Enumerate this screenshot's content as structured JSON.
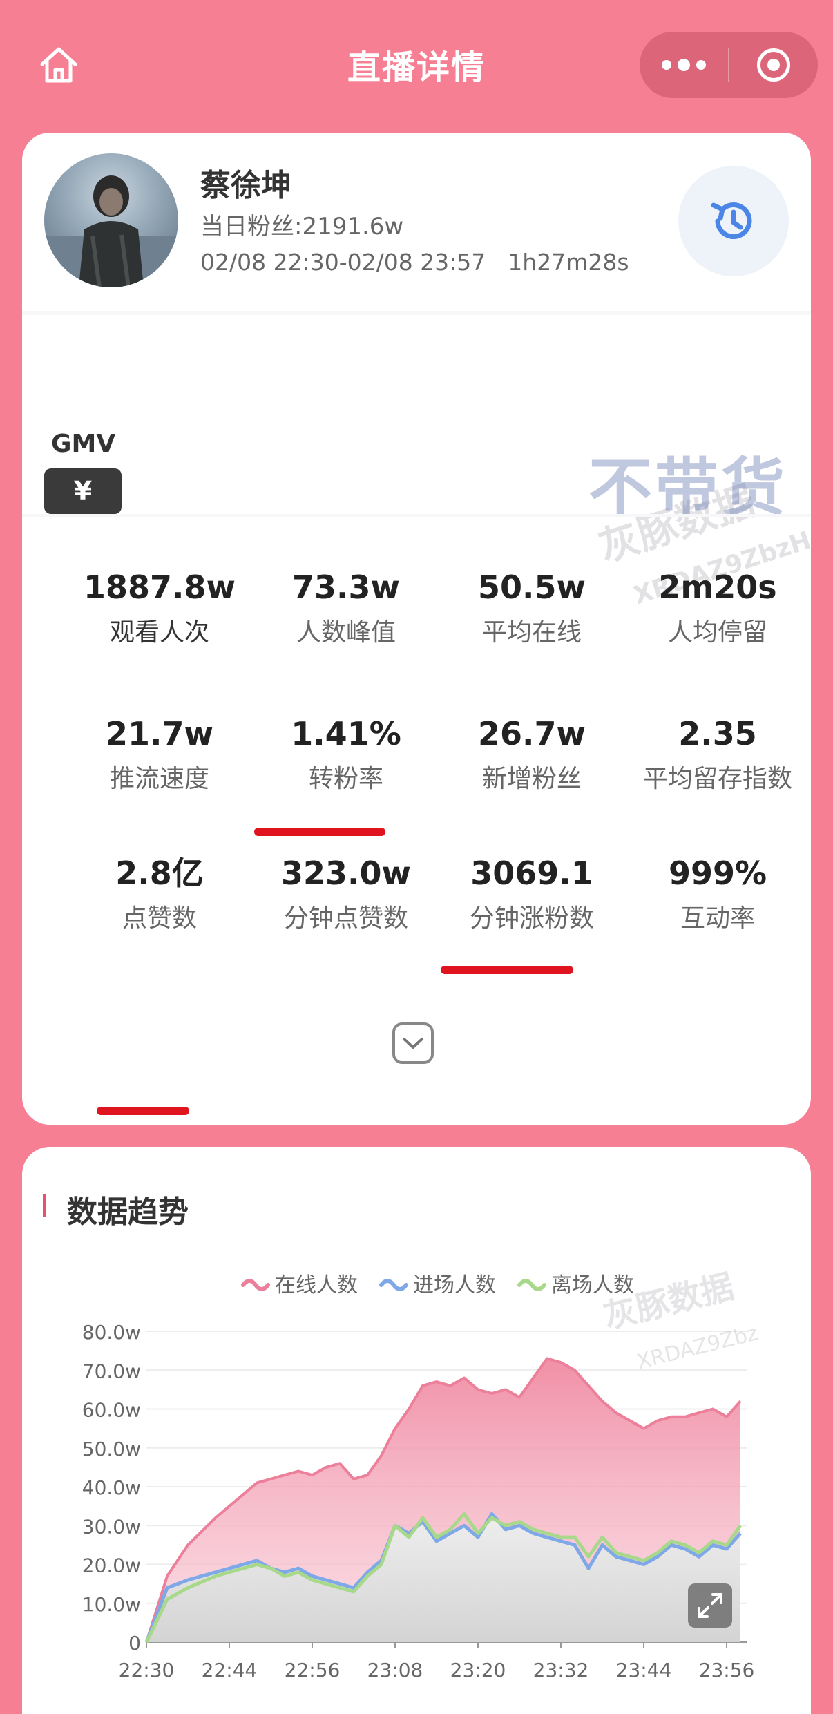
{
  "header": {
    "title": "直播详情",
    "home_icon": "home-icon",
    "more_icon": "more-dots-icon",
    "close_icon": "target-close-icon"
  },
  "profile": {
    "name": "蔡徐坤",
    "fans": "当日粉丝:2191.6w",
    "time_range": "02/08 22:30-02/08 23:57",
    "duration": "1h27m28s",
    "history_icon": "history-icon"
  },
  "gmv": {
    "label": "GMV",
    "badge": "¥",
    "status": "不带货"
  },
  "watermark": {
    "brand": "灰豚数据",
    "code": "XRDAZ9ZbzH",
    "code2": "XRDAZ9Zbz"
  },
  "stats": [
    {
      "value": "1887.8w",
      "label": "观看人次",
      "underlined": false
    },
    {
      "value": "73.3w",
      "label": "人数峰值",
      "underlined": true
    },
    {
      "value": "50.5w",
      "label": "平均在线",
      "underlined": false
    },
    {
      "value": "2m20s",
      "label": "人均停留",
      "underlined": false
    },
    {
      "value": "21.7w",
      "label": "推流速度",
      "underlined": false
    },
    {
      "value": "1.41%",
      "label": "转粉率",
      "underlined": false
    },
    {
      "value": "26.7w",
      "label": "新增粉丝",
      "underlined": true
    },
    {
      "value": "2.35",
      "label": "平均留存指数",
      "underlined": false
    },
    {
      "value": "2.8亿",
      "label": "点赞数",
      "underlined": true
    },
    {
      "value": "323.0w",
      "label": "分钟点赞数",
      "underlined": false
    },
    {
      "value": "3069.1",
      "label": "分钟涨粉数",
      "underlined": false
    },
    {
      "value": "999%",
      "label": "互动率",
      "underlined": false
    }
  ],
  "colors": {
    "background": "#f67f93",
    "online": "#ec7f9a",
    "enter": "#7fa8e8",
    "leave": "#a8d98a",
    "underline": "#e0141e"
  },
  "trend": {
    "title": "数据趋势",
    "fullscreen_icon": "fullscreen-icon"
  },
  "chart_data": {
    "type": "area",
    "title": "",
    "xlabel": "",
    "ylabel": "",
    "legend_position": "top-center",
    "grid": true,
    "ylim": [
      0,
      80
    ],
    "y_unit": "w",
    "y_ticks": [
      "0",
      "10.0w",
      "20.0w",
      "30.0w",
      "40.0w",
      "50.0w",
      "60.0w",
      "70.0w",
      "80.0w"
    ],
    "x_ticks": [
      "22:30",
      "22:44",
      "22:56",
      "23:08",
      "23:20",
      "23:32",
      "23:44",
      "23:56"
    ],
    "x_minutes": [
      0,
      3,
      6,
      10,
      14,
      16,
      18,
      20,
      22,
      24,
      26,
      28,
      30,
      32,
      34,
      36,
      38,
      40,
      42,
      44,
      46,
      48,
      50,
      52,
      54,
      56,
      58,
      60,
      62,
      64,
      66,
      68,
      70,
      72,
      74,
      76,
      78,
      80,
      82,
      84,
      86
    ],
    "series": [
      {
        "name": "在线人数",
        "values": [
          0,
          17,
          25,
          32,
          38,
          41,
          42,
          43,
          44,
          43,
          45,
          46,
          42,
          43,
          48,
          55,
          60,
          66,
          67,
          66,
          68,
          65,
          64,
          65,
          63,
          68,
          73,
          72,
          70,
          66,
          62,
          59,
          57,
          55,
          57,
          58,
          58,
          59,
          60,
          58,
          62
        ]
      },
      {
        "name": "进场人数",
        "values": [
          0,
          14,
          16,
          18,
          20,
          21,
          19,
          18,
          19,
          17,
          16,
          15,
          14,
          18,
          21,
          30,
          28,
          31,
          26,
          28,
          30,
          27,
          33,
          29,
          30,
          28,
          27,
          26,
          25,
          19,
          25,
          22,
          21,
          20,
          22,
          25,
          24,
          22,
          25,
          24,
          28
        ]
      },
      {
        "name": "离场人数",
        "values": [
          0,
          11,
          14,
          17,
          19,
          20,
          19,
          17,
          18,
          16,
          15,
          14,
          13,
          17,
          20,
          30,
          27,
          32,
          27,
          29,
          33,
          28,
          32,
          30,
          31,
          29,
          28,
          27,
          27,
          22,
          27,
          23,
          22,
          21,
          23,
          26,
          25,
          23,
          26,
          25,
          30
        ]
      }
    ]
  }
}
